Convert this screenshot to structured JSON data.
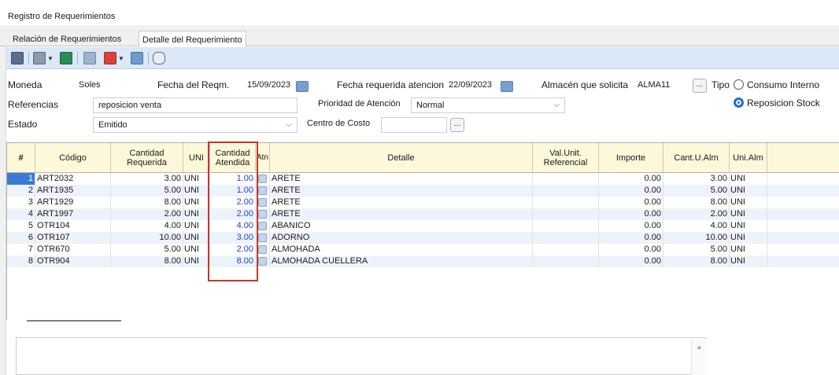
{
  "window": {
    "title": "Registro de Requerimientos"
  },
  "tabs": [
    {
      "label": "Relación de Requerimientos"
    },
    {
      "label": "Detalle del Requerimiento"
    }
  ],
  "form": {
    "moneda_label": "Moneda",
    "moneda_value": "Soles",
    "fecha_reqm_label": "Fecha del Reqm.",
    "fecha_reqm_value": "15/09/2023",
    "fecha_atencion_label": "Fecha requerida atencion",
    "fecha_atencion_value": "22/09/2023",
    "almacen_label": "Almacén que solicita",
    "almacen_value": "ALMA11",
    "tipo_label": "Tipo",
    "tipo_options": [
      {
        "label": "Consumo Interno",
        "selected": false
      },
      {
        "label": "Reposicion Stock",
        "selected": true
      }
    ],
    "referencias_label": "Referencias",
    "referencias_value": "reposicion venta",
    "prioridad_label": "Prioridad de Atención",
    "prioridad_value": "Normal",
    "estado_label": "Estado",
    "estado_value": "Emitido",
    "centro_costo_label": "Centro de Costo",
    "centro_costo_value": ""
  },
  "grid": {
    "headers": {
      "num": "#",
      "codigo": "Código",
      "cant_req": "Cantidad Requerida",
      "uni": "UNI",
      "cant_atendida": "Cantidad Atendida",
      "atn": "Atn",
      "detalle": "Detalle",
      "val_unit": "Val.Unit. Referencial",
      "importe": "Importe",
      "cant_u_alm": "Cant.U.Alm",
      "uni_alm": "Uni.Alm"
    },
    "rows": [
      {
        "num": "1",
        "codigo": "ART2032",
        "cant_req": "3.00",
        "uni": "UNI",
        "cant_atendida": "1.00",
        "detalle": "ARETE",
        "val_unit": "",
        "importe": "0.00",
        "cant_u_alm": "3.00",
        "uni_alm": "UNI"
      },
      {
        "num": "2",
        "codigo": "ART1935",
        "cant_req": "5.00",
        "uni": "UNI",
        "cant_atendida": "1.00",
        "detalle": "ARETE",
        "val_unit": "",
        "importe": "0.00",
        "cant_u_alm": "5.00",
        "uni_alm": "UNI"
      },
      {
        "num": "3",
        "codigo": "ART1929",
        "cant_req": "8.00",
        "uni": "UNI",
        "cant_atendida": "2.00",
        "detalle": "ARETE",
        "val_unit": "",
        "importe": "0.00",
        "cant_u_alm": "8.00",
        "uni_alm": "UNI"
      },
      {
        "num": "4",
        "codigo": "ART1997",
        "cant_req": "2.00",
        "uni": "UNI",
        "cant_atendida": "2.00",
        "detalle": "ARETE",
        "val_unit": "",
        "importe": "0.00",
        "cant_u_alm": "2.00",
        "uni_alm": "UNI"
      },
      {
        "num": "5",
        "codigo": "OTR104",
        "cant_req": "4.00",
        "uni": "UNI",
        "cant_atendida": "4.00",
        "detalle": "ABANICO",
        "val_unit": "",
        "importe": "0.00",
        "cant_u_alm": "4.00",
        "uni_alm": "UNI"
      },
      {
        "num": "6",
        "codigo": "OTR107",
        "cant_req": "10.00",
        "uni": "UNI",
        "cant_atendida": "3.00",
        "detalle": "ADORNO",
        "val_unit": "",
        "importe": "0.00",
        "cant_u_alm": "10.00",
        "uni_alm": "UNI"
      },
      {
        "num": "7",
        "codigo": "OTR670",
        "cant_req": "5.00",
        "uni": "UNI",
        "cant_atendida": "2.00",
        "detalle": "ALMOHADA",
        "val_unit": "",
        "importe": "0.00",
        "cant_u_alm": "5.00",
        "uni_alm": "UNI"
      },
      {
        "num": "8",
        "codigo": "OTR904",
        "cant_req": "8.00",
        "uni": "UNI",
        "cant_atendida": "8.00",
        "detalle": "ALMOHADA CUELLERA",
        "val_unit": "",
        "importe": "0.00",
        "cant_u_alm": "8.00",
        "uni_alm": "UNI"
      }
    ]
  },
  "toolbar": {
    "icons": [
      "save-icon",
      "print-icon",
      "excel-icon",
      "document-icon",
      "pdf-icon",
      "report-icon",
      "email-icon"
    ]
  },
  "colors": {
    "toolbar_bg": "#dbe8f7",
    "header_bg": "#fdf8da",
    "alt_row": "#edf3fb",
    "highlight": "#c0392b",
    "atendida_blue": "#1f3fcf",
    "radio_selected": "#1f6fd1"
  }
}
